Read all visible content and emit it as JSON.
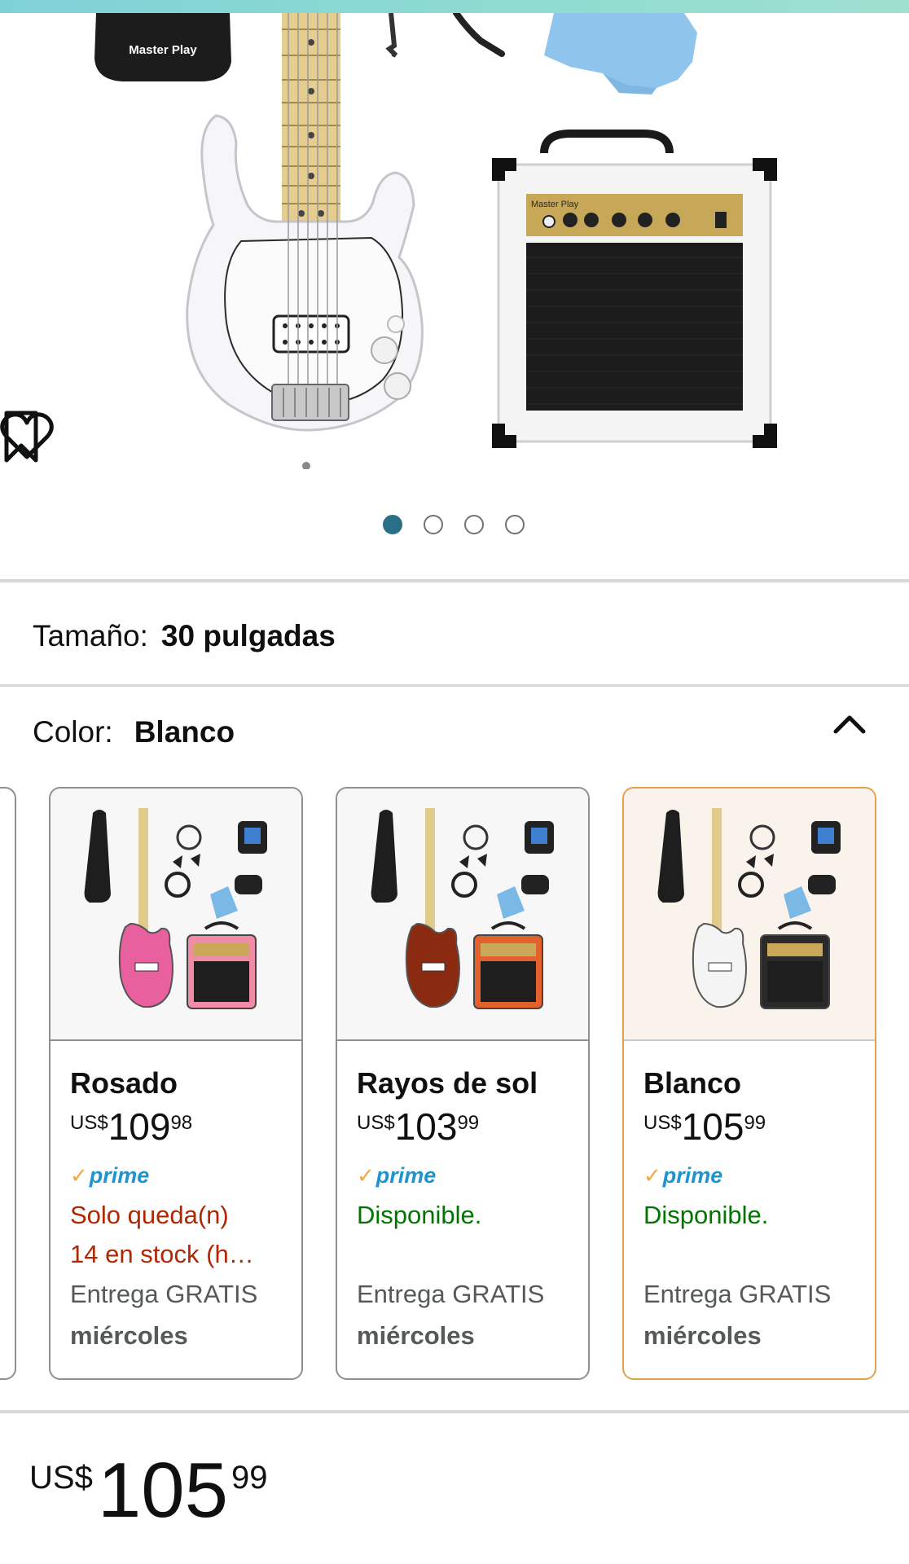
{
  "hero": {
    "bag_label": "Master Play",
    "amp_label": "Master Play",
    "carousel_total": 4,
    "carousel_active": 1
  },
  "options": {
    "size_label": "Tamaño:",
    "size_value": "30 pulgadas",
    "color_label": "Color:",
    "color_value": "Blanco"
  },
  "variants": [
    {
      "name": "Rosado",
      "currency": "US$",
      "whole": "109",
      "fraction": "98",
      "prime": "prime",
      "stock_line1": "Solo queda(n)",
      "stock_line2": "14 en stock (h…",
      "stock_type": "low",
      "delivery": "Entrega GRATIS",
      "delivery_day": "miércoles",
      "selected": false,
      "guitar_color": "#e8609e",
      "amp_color": "#f18ca6"
    },
    {
      "name": "Rayos de sol",
      "currency": "US$",
      "whole": "103",
      "fraction": "99",
      "prime": "prime",
      "stock_line1": "Disponible.",
      "stock_type": "ok",
      "delivery": "Entrega GRATIS",
      "delivery_day": "miércoles",
      "selected": false,
      "guitar_color": "#8a2a10",
      "amp_color": "#e4612e"
    },
    {
      "name": "Blanco",
      "currency": "US$",
      "whole": "105",
      "fraction": "99",
      "prime": "prime",
      "stock_line1": "Disponible.",
      "stock_type": "ok",
      "delivery": "Entrega GRATIS",
      "delivery_day": "miércoles",
      "selected": true,
      "guitar_color": "#f4f4f4",
      "amp_color": "#2a2a2a"
    }
  ],
  "price": {
    "currency": "US$",
    "whole": "105",
    "fraction": "99"
  },
  "colors": {
    "accent_selected": "#e2a14c",
    "dot_active": "#2a6f86",
    "prime_blue": "#1e94cf",
    "low_stock": "#b12704",
    "in_stock": "#007600"
  }
}
